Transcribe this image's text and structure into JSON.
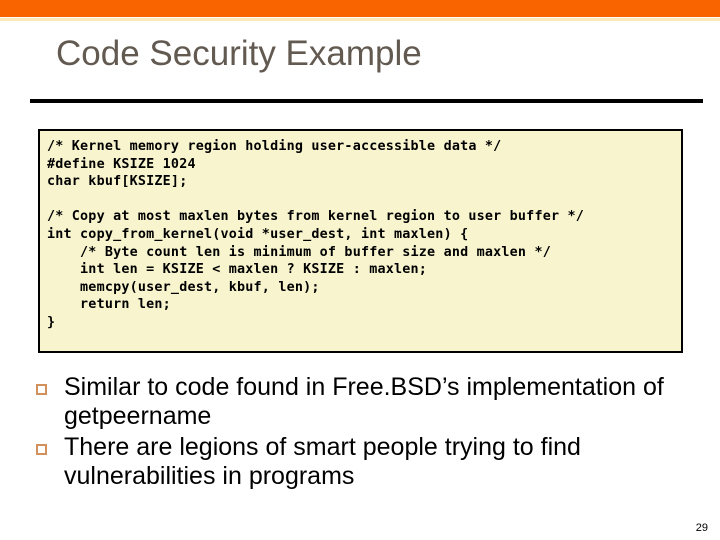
{
  "slide": {
    "title": "Code Security Example",
    "page_number": "29",
    "accent_color": "#FA6400",
    "title_color": "#625950",
    "code_bg_color": "#F7F4CE",
    "bullet_marker_color": "#D2905C"
  },
  "code_block": {
    "language": "c",
    "text": "/* Kernel memory region holding user-accessible data */\n#define KSIZE 1024\nchar kbuf[KSIZE];\n\n/* Copy at most maxlen bytes from kernel region to user buffer */\nint copy_from_kernel(void *user_dest, int maxlen) {\n    /* Byte count len is minimum of buffer size and maxlen */\n    int len = KSIZE < maxlen ? KSIZE : maxlen;\n    memcpy(user_dest, kbuf, len);\n    return len;\n}",
    "lines": [
      "/* Kernel memory region holding user-accessible data */",
      "#define KSIZE 1024",
      "char kbuf[KSIZE];",
      "",
      "/* Copy at most maxlen bytes from kernel region to user buffer */",
      "int copy_from_kernel(void *user_dest, int maxlen) {",
      "    /* Byte count len is minimum of buffer size and maxlen */",
      "    int len = KSIZE < maxlen ? KSIZE : maxlen;",
      "    memcpy(user_dest, kbuf, len);",
      "    return len;",
      "}"
    ]
  },
  "bullets": [
    {
      "text": "Similar to code found in Free.BSD’s implementation of getpeername"
    },
    {
      "text": "There are legions of smart people trying to find vulnerabilities in programs"
    }
  ]
}
